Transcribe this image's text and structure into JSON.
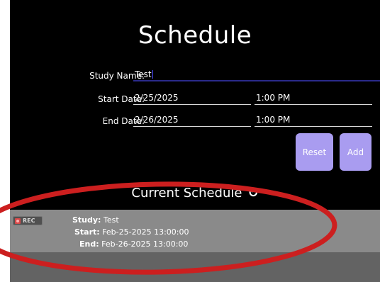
{
  "page": {
    "title": "Schedule"
  },
  "form": {
    "study_name_label": "Study Name:",
    "study_name_value": "Test",
    "start_date_label": "Start Date:",
    "start_date_value": "2/25/2025",
    "start_time_value": "1:00 PM",
    "end_date_label": "End Date:",
    "end_date_value": "2/26/2025",
    "end_time_value": "1:00 PM"
  },
  "buttons": {
    "reset_label": "Reset",
    "add_label": "Add"
  },
  "current_schedule": {
    "title": "Current Schedule",
    "refresh_icon": "refresh-icon",
    "rec_badge": "REC",
    "items": [
      {
        "study_label": "Study:",
        "study_value": "Test",
        "start_label": "Start:",
        "start_value": "Feb-25-2025 13:00:00",
        "end_label": "End:",
        "end_value": "Feb-26-2025 13:00:00"
      }
    ]
  },
  "colors": {
    "background": "#000000",
    "button": "#a99cf0",
    "card": "#8a8a8a",
    "annotation": "#cc1f1f"
  }
}
